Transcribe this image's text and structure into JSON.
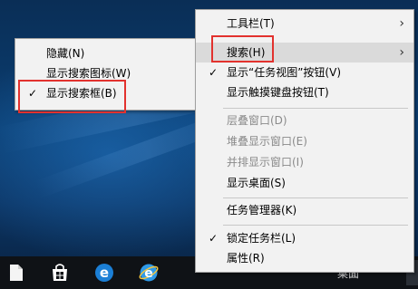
{
  "submenu": {
    "items": [
      {
        "label": "隐藏(N)",
        "checked": false
      },
      {
        "label": "显示搜索图标(W)",
        "checked": false
      },
      {
        "label": "显示搜索框(B)",
        "checked": true
      }
    ]
  },
  "context_menu": {
    "items": [
      {
        "label": "工具栏(T)",
        "has_submenu": true
      },
      {
        "label": "搜索(H)",
        "has_submenu": true
      },
      {
        "label": "显示“任务视图”按钮(V)",
        "checked": true
      },
      {
        "label": "显示触摸键盘按钮(T)"
      },
      {
        "label": "层叠窗口(D)",
        "disabled": true
      },
      {
        "label": "堆叠显示窗口(E)",
        "disabled": true
      },
      {
        "label": "并排显示窗口(I)",
        "disabled": true
      },
      {
        "label": "显示桌面(S)"
      },
      {
        "label": "任务管理器(K)"
      },
      {
        "label": "锁定任务栏(L)",
        "checked": true
      },
      {
        "label": "属性(R)"
      }
    ]
  },
  "glyphs": {
    "check": "✓",
    "submenu_arrow": "›"
  },
  "taskbar": {
    "desktop_label": "桌面",
    "overflow_arrow": "^",
    "icons": [
      "file-icon",
      "store-icon",
      "edge-icon",
      "ie-icon"
    ]
  },
  "colors": {
    "menu_bg": "#f2f2f2",
    "highlight": "#dadada",
    "annotation": "#e2322e",
    "taskbar": "#0f1216"
  }
}
